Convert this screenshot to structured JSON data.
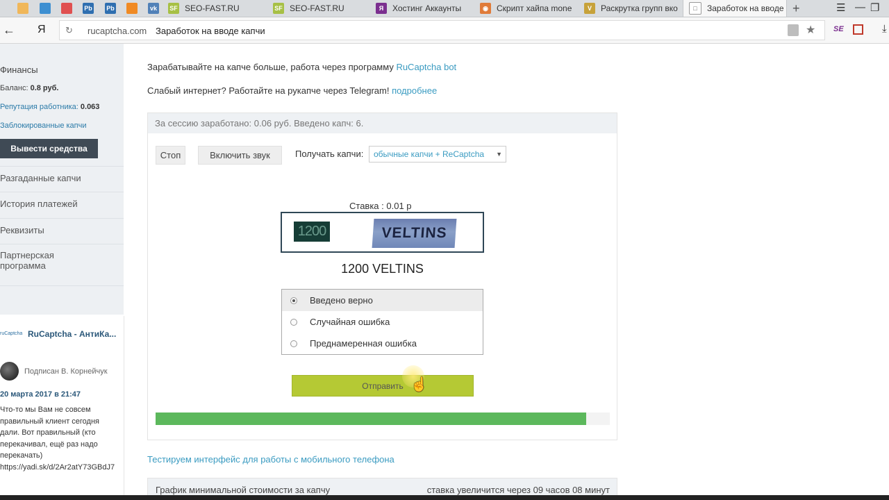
{
  "browser": {
    "tabs": [
      {
        "label": "",
        "color": "#f0b75a"
      },
      {
        "label": "",
        "color": "#3d8fd1"
      },
      {
        "label": "",
        "color": "#e05050"
      },
      {
        "label": "",
        "color": "#2f6fb0",
        "glyph": "Pb"
      },
      {
        "label": "",
        "color": "#2f6fb0",
        "glyph": "Pb"
      },
      {
        "label": "",
        "color": "#f08a24"
      },
      {
        "label": "",
        "color": "#5181b8",
        "glyph": "vk"
      },
      {
        "label": "SEO-FAST.RU",
        "color": "#a7c045",
        "glyph": "SF"
      },
      {
        "label": "SEO-FAST.RU",
        "color": "#a7c045",
        "glyph": "SF"
      },
      {
        "label": "Хостинг Аккаунты",
        "color": "#7b2f8f",
        "glyph": "Я"
      },
      {
        "label": "Скрипт хайпа mone",
        "color": "#e07b39",
        "glyph": "◉"
      },
      {
        "label": "Раскрутка групп вко",
        "color": "#c7a23a",
        "glyph": "V"
      },
      {
        "label": "Заработок на вводе",
        "color": "#ffffff",
        "glyph": "□"
      }
    ],
    "domain": "rucaptcha.com",
    "page_title": "Заработок на вводе капчи",
    "yandex_label": "Я",
    "ext_label": "SE",
    "icons": [
      "back-arrow-icon",
      "reload-icon",
      "lock-icon",
      "star-icon",
      "menu-icon",
      "minimize-icon",
      "maximize-icon",
      "download-icon"
    ]
  },
  "sidebar": {
    "finance_title": "Финансы",
    "balance_label": "Баланс:",
    "balance_value": "0.8 руб.",
    "reputation_label": "Репутация работника:",
    "reputation_value": "0.063",
    "blocked_label": "Заблокированные капчи",
    "withdraw_label": "Вывести средства",
    "nav": [
      "Разгаданные капчи",
      "История платежей",
      "Реквизиты",
      "Партнерская программа"
    ]
  },
  "vk_widget": {
    "logo_text": "ruCaptcha",
    "group_name": "RuCaptcha - АнтиКа...",
    "signed_by": "Подписан В. Корнейчук",
    "date": "20 марта 2017 в 21:47",
    "text": "Что-то мы Вам не совсем правильный клиент сегодня дали. Вот правильный (кто перекачивал, ещё раз надо перекачать) https://yadi.sk/d/2Ar2atY73GBdJ7"
  },
  "main": {
    "promo1_text": "Зарабатывайте на капче больше, работа через программу ",
    "promo1_link": "RuCaptcha bot",
    "promo2_text": "Слабый интернет? Работайте на рукапче через Telegram! ",
    "promo2_link": "подробнее",
    "session_text": "За сессию заработано: 0.06 руб. Введено капч: 6.",
    "stop_label": "Стоп",
    "sound_label": "Включить звук",
    "get_label": "Получать капчи:",
    "mode_value": "обычные капчи + ReCaptcha",
    "rate_text": "Ставка : 0.01 р",
    "captcha_part1": "1200",
    "captcha_part2": "VELTINS",
    "answer": "1200 VELTINS",
    "options": [
      "Введено верно",
      "Случайная ошибка",
      "Преднамеренная ошибка"
    ],
    "selected_option": 0,
    "submit_label": "Отправить",
    "progress": 0.948,
    "mobile_link": "Тестируем интерфейс для работы с мобильного телефона",
    "graph_title": "График минимальной стоимости за капчу",
    "graph_timer": "ставка увеличится через 09 часов 08 минут"
  },
  "colors": {
    "accent_link": "#3a9bc1",
    "submit_green": "#b5c934",
    "progress_green": "#5cb85c",
    "sidebar_bg": "#edf0f3",
    "withdraw_dark": "#3f4a55"
  }
}
